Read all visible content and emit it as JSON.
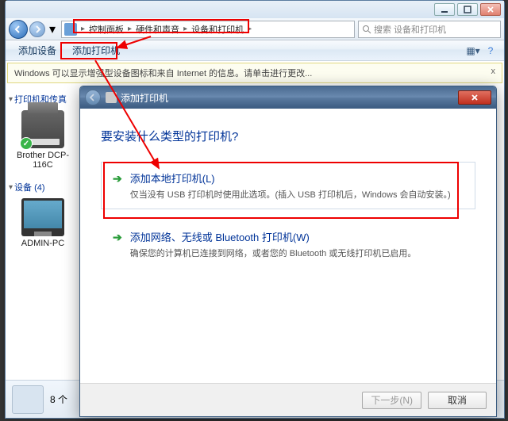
{
  "breadcrumb": {
    "root_icon": "control-panel-icon",
    "seg1": "控制面板",
    "seg2": "硬件和声音",
    "seg3": "设备和打印机"
  },
  "search": {
    "placeholder": "搜索 设备和打印机"
  },
  "toolbar": {
    "add_device": "添加设备",
    "add_printer": "添加打印机"
  },
  "infobar": {
    "text": "Windows 可以显示增强型设备图标和来自 Internet 的信息。请单击进行更改...",
    "close": "x"
  },
  "sidebar": {
    "sec1": {
      "label": "打印机和传真",
      "count_suffix": ""
    },
    "dev1": {
      "name": "Brother DCP-116C"
    },
    "sec2": {
      "label": "设备 (4)"
    },
    "dev2": {
      "name": "ADMIN-PC"
    }
  },
  "statusbar": {
    "count": "8",
    "suffix": "个"
  },
  "dialog": {
    "backIcon": "back-arrow-icon",
    "printerIcon": "printer-small-icon",
    "title": "添加打印机",
    "heading": "要安装什么类型的打印机?",
    "opt1": {
      "title": "添加本地打印机(L)",
      "desc": "仅当没有 USB 打印机时使用此选项。(插入 USB 打印机后，Windows 会自动安装。)"
    },
    "opt2": {
      "title": "添加网络、无线或 Bluetooth 打印机(W)",
      "desc": "确保您的计算机已连接到网络，或者您的 Bluetooth 或无线打印机已启用。"
    },
    "next": "下一步(N)",
    "cancel": "取消"
  }
}
